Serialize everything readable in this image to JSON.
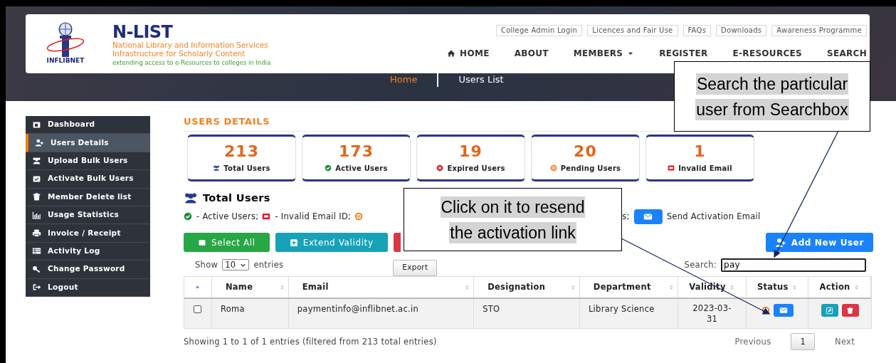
{
  "header": {
    "logo_badge": "INFLIBNET",
    "title": "N-LIST",
    "subtitle_lines": [
      "National Library and Information Services",
      "Infrastructure for Scholarly Content"
    ],
    "tagline": "extending access to e-Resources to colleges in India",
    "top_links": [
      "College Admin Login",
      "Licences and Fair Use",
      "FAQs",
      "Downloads",
      "Awareness Programme"
    ],
    "nav": [
      {
        "label": "HOME",
        "kind": "home"
      },
      {
        "label": "ABOUT",
        "kind": "plain"
      },
      {
        "label": "MEMBERS",
        "kind": "dropdown"
      },
      {
        "label": "REGISTER",
        "kind": "plain"
      },
      {
        "label": "E-RESOURCES",
        "kind": "plain"
      },
      {
        "label": "SEARCH",
        "kind": "plain"
      }
    ],
    "breadcrumb": [
      "Home",
      "Users List"
    ]
  },
  "sidebar": {
    "items": [
      {
        "label": "Dashboard",
        "selected": false
      },
      {
        "label": "Users Details",
        "selected": true
      },
      {
        "label": "Upload Bulk Users",
        "selected": false
      },
      {
        "label": "Activate Bulk Users",
        "selected": false
      },
      {
        "label": "Member Delete list",
        "selected": false
      },
      {
        "label": "Usage Statistics",
        "selected": false
      },
      {
        "label": "Invoice / Receipt",
        "selected": false
      },
      {
        "label": "Activity Log",
        "selected": false
      },
      {
        "label": "Change Password",
        "selected": false
      },
      {
        "label": "Logout",
        "selected": false
      }
    ]
  },
  "section_title": "USERS DETAILS",
  "stats": [
    {
      "value": "213",
      "label": "Total Users"
    },
    {
      "value": "173",
      "label": "Active Users"
    },
    {
      "value": "19",
      "label": "Expired Users"
    },
    {
      "value": "20",
      "label": "Pending Users"
    },
    {
      "value": "1",
      "label": "Invalid Email"
    }
  ],
  "list_heading": "Total Users",
  "legend": [
    "- Active Users;",
    "- Invalid Email ID;",
    "s;",
    "Send Activation Email"
  ],
  "buttons": [
    {
      "label": "Select All",
      "kind": "select"
    },
    {
      "label": "Extend Validity",
      "kind": "extend"
    },
    {
      "kind": "hidden-danger"
    }
  ],
  "add_button": "Add New User",
  "length": {
    "before": "Show",
    "value": "10",
    "after": "entries"
  },
  "export_button": "Export",
  "search": {
    "label": "Search:",
    "value": "pay"
  },
  "table": {
    "columns": [
      "Name",
      "Email",
      "Designation",
      "Department",
      "Validity",
      "Status",
      "Action"
    ],
    "rows": [
      {
        "checked": false,
        "name": "Roma",
        "email": "paymentinfo@inflibnet.ac.in",
        "designation": "STO",
        "department": "Library Science",
        "validity": "2023-03-31"
      }
    ]
  },
  "info": "Showing 1 to 1 of 1 entries (filtered from 213 total entries)",
  "pagination": [
    {
      "label": "Previous",
      "selected": false
    },
    {
      "label": "1",
      "selected": true
    },
    {
      "label": "Next",
      "selected": false
    }
  ],
  "callouts": [
    {
      "text_lines": [
        "Search the particular",
        "user from Searchbox"
      ],
      "kind": "search"
    },
    {
      "text_lines": [
        "Click on it to resend",
        "the activation link"
      ],
      "kind": "status"
    }
  ]
}
